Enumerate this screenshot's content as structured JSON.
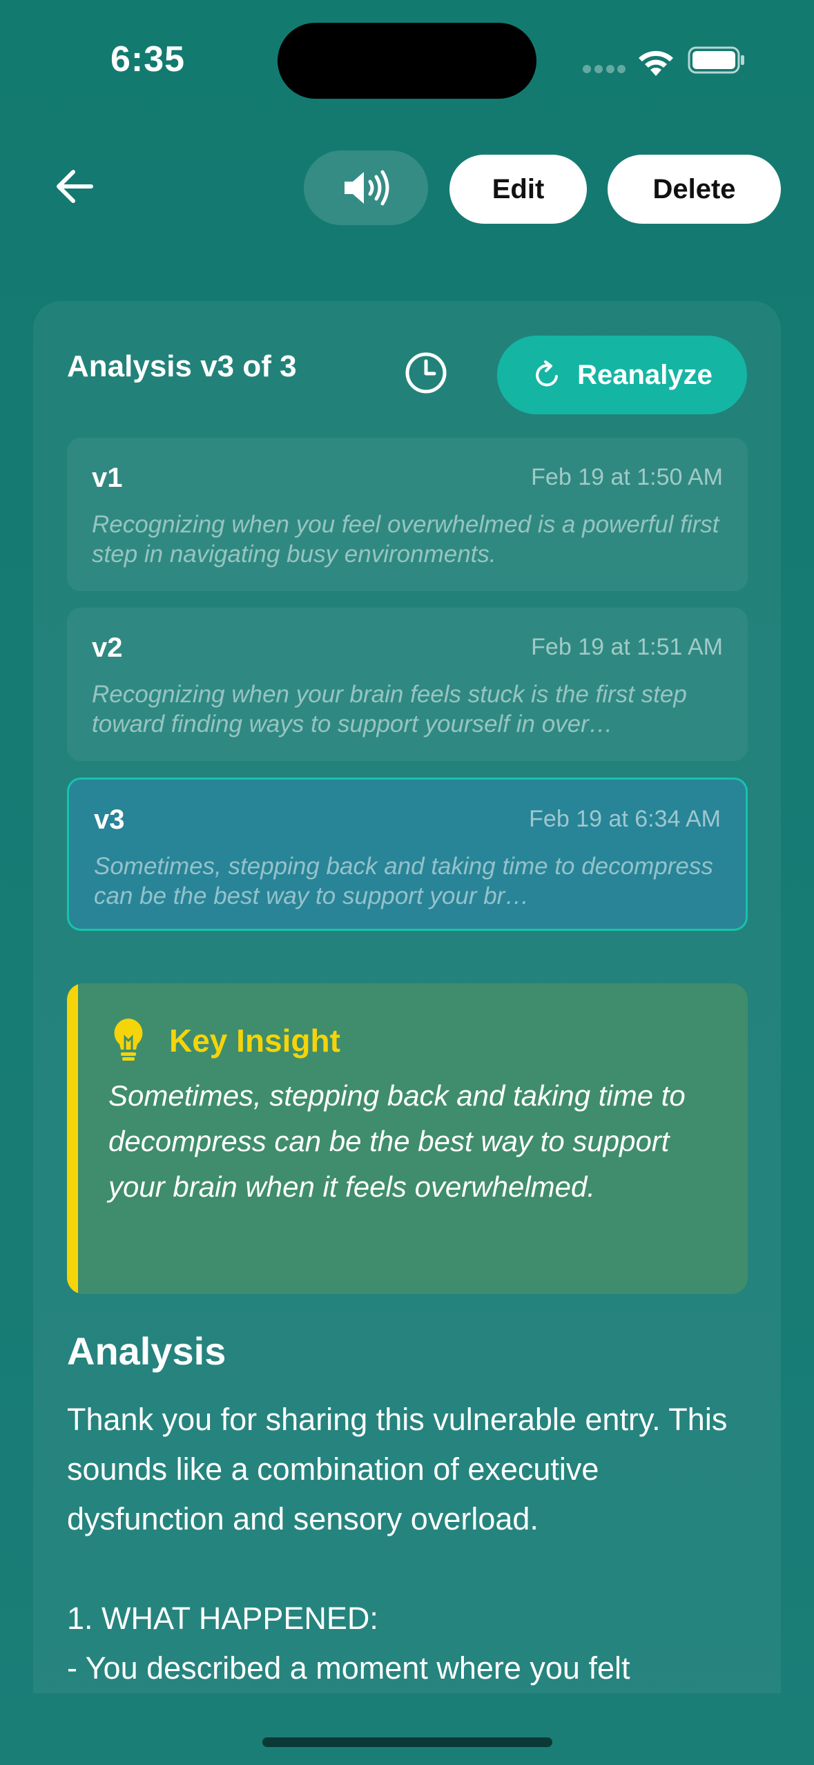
{
  "status_bar": {
    "time": "6:35"
  },
  "toolbar": {
    "edit_label": "Edit",
    "delete_label": "Delete",
    "back_icon": "arrow-left-icon",
    "speaker_icon": "speaker-wave-icon"
  },
  "analysis": {
    "header": "Analysis v3 of 3",
    "history_icon": "clock-icon",
    "reanalyze_label": "Reanalyze",
    "selected_version": "v3",
    "versions": [
      {
        "label": "v1",
        "date": "Feb 19 at 1:50 AM",
        "snippet": "Recognizing when you feel overwhelmed is a powerful first step in navigating busy environments."
      },
      {
        "label": "v2",
        "date": "Feb 19 at 1:51 AM",
        "snippet": "Recognizing when your brain feels stuck is the first step toward finding ways to support yourself in over…"
      },
      {
        "label": "v3",
        "date": "Feb 19 at 6:34 AM",
        "snippet": "Sometimes, stepping back and taking time to decompress can be the best way to support your br…"
      }
    ]
  },
  "insight": {
    "title": "Key Insight",
    "text": "Sometimes, stepping back and taking time to decompress can be the best way to support your brain when it feels overwhelmed.",
    "icon": "lightbulb-icon"
  },
  "body": {
    "title": "Analysis",
    "text": "Thank you for sharing this vulnerable entry. This sounds like a combination of executive dysfunction and sensory overload.\n\n1. WHAT HAPPENED:\n- You described a moment where you felt"
  },
  "colors": {
    "background": "#137a70",
    "accent": "#15b5a3",
    "insight_bg": "#3f8d6c",
    "insight_accent": "#f5d40a"
  }
}
